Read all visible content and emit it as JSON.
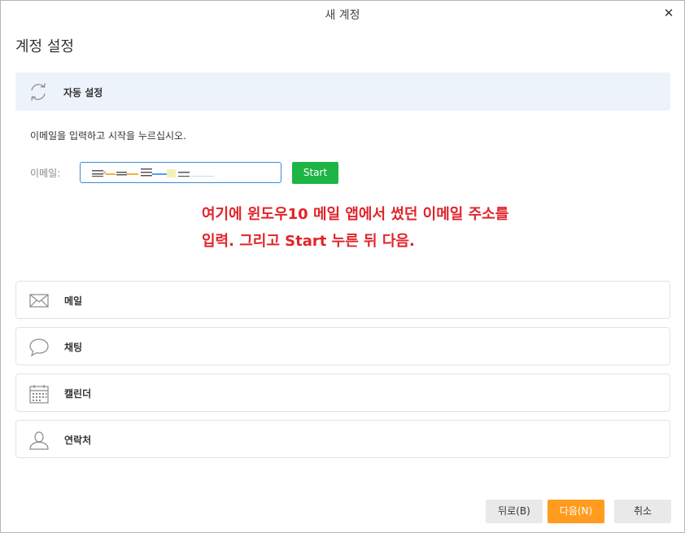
{
  "window": {
    "title": "새 계정",
    "close_glyph": "✕"
  },
  "page": {
    "title": "계정 설정"
  },
  "auto_setup": {
    "label": "자동 설정",
    "icon": "refresh-icon",
    "background": "#edf3fa"
  },
  "form": {
    "instruction": "이메일을 입력하고 시작을 누르십시오.",
    "email_label": "이메일:",
    "email_value": "",
    "start_label": "Start",
    "start_color": "#1db544"
  },
  "annotation": {
    "line1": "여기에 윈도우10 메일 앱에서 썼던 이메일 주소를",
    "line2": "입력.  그리고 Start 누른 뒤 다음.",
    "color": "#e0242a"
  },
  "services": [
    {
      "label": "메일",
      "icon": "mail-icon"
    },
    {
      "label": "채팅",
      "icon": "chat-bubble-icon"
    },
    {
      "label": "캘린더",
      "icon": "calendar-icon"
    },
    {
      "label": "연락처",
      "icon": "person-icon"
    }
  ],
  "footer": {
    "back_label": "뒤로(B)",
    "next_label": "다음(N)",
    "cancel_label": "취소",
    "next_color": "#ff9b1e"
  }
}
